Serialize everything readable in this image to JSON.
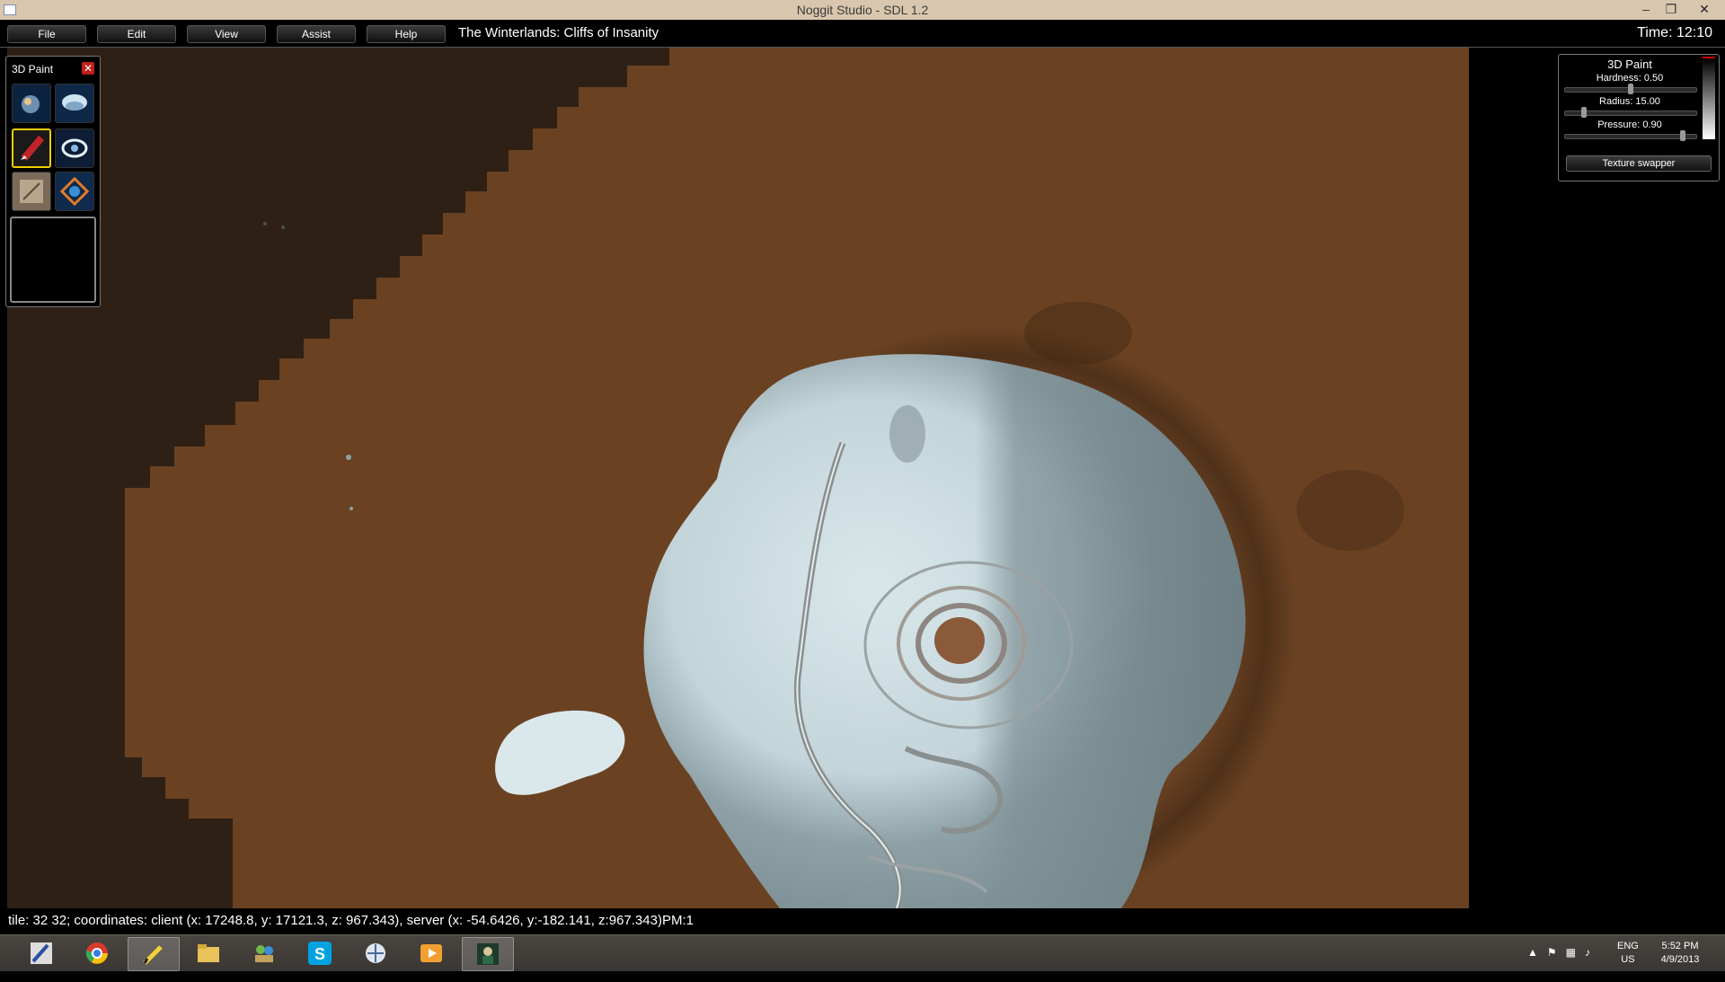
{
  "window": {
    "title": "Noggit Studio - SDL 1.2",
    "controls": {
      "minimize": "–",
      "restore": "❐",
      "close": "✕"
    }
  },
  "menubar": {
    "items": [
      "File",
      "Edit",
      "View",
      "Assist",
      "Help"
    ],
    "map_name": "The Winterlands: Cliffs of Insanity",
    "time": "Time: 12:10"
  },
  "palette": {
    "title": "3D Paint",
    "close": "✕",
    "tools": [
      {
        "name": "raise-lower-tool"
      },
      {
        "name": "flatten-blur-tool"
      },
      {
        "name": "texture-paint-tool",
        "selected": true
      },
      {
        "name": "water-tool"
      },
      {
        "name": "item-selection-tool"
      },
      {
        "name": "holes-tool"
      }
    ]
  },
  "settings": {
    "title": "3D Paint",
    "hardness": {
      "label": "Hardness: 0.50",
      "value": 0.5
    },
    "radius": {
      "label": "Radius: 15.00",
      "value": 0.12
    },
    "pressure": {
      "label": "Pressure: 0.90",
      "value": 0.9
    },
    "texture_swapper": "Texture swapper"
  },
  "statusbar": {
    "text": "tile: 32 32; coordinates: client (x: 17248.8, y: 17121.3, z: 967.343), server (x: -54.6426, y:-182.141, z:967.343)PM:1"
  },
  "taskbar": {
    "apps": [
      "pen-app-icon",
      "chrome-icon",
      "pencil-app-icon",
      "file-explorer-icon",
      "people-app-icon",
      "skype-icon",
      "network-app-icon",
      "media-player-icon",
      "noggit-icon"
    ],
    "tray": {
      "language": "ENG",
      "region": "US",
      "time": "5:52 PM",
      "date": "4/9/2013"
    }
  },
  "colors": {
    "terrain_brown": "#6a4222",
    "terrain_dark": "#2f2015",
    "snow_light": "#d6e4e8",
    "snow_shadow": "#7e9197",
    "title_bar": "#d9c6ae",
    "selected_tool": "#f0d000"
  }
}
